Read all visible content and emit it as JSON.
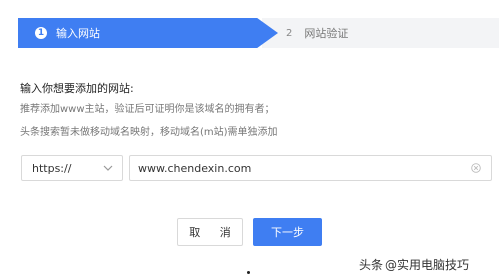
{
  "steps": [
    {
      "num": "1",
      "label": "输入网站"
    },
    {
      "num": "2",
      "label": "网站验证"
    }
  ],
  "form": {
    "title": "输入你想要添加的网站:",
    "hint1": "推荐添加www主站，验证后可证明你是该域名的拥有者；",
    "hint2": "头条搜索暂未做移动域名映射，移动域名(m站)需单独添加",
    "protocol": "https://",
    "domain_value": "www.chendexin.com"
  },
  "buttons": {
    "cancel": "取 消",
    "next": "下一步"
  },
  "watermark": {
    "platform": "头条",
    "account": "@实用电脑技巧"
  },
  "colors": {
    "accent": "#3f7ef2",
    "step_inactive_bg": "#f3f4f6"
  }
}
